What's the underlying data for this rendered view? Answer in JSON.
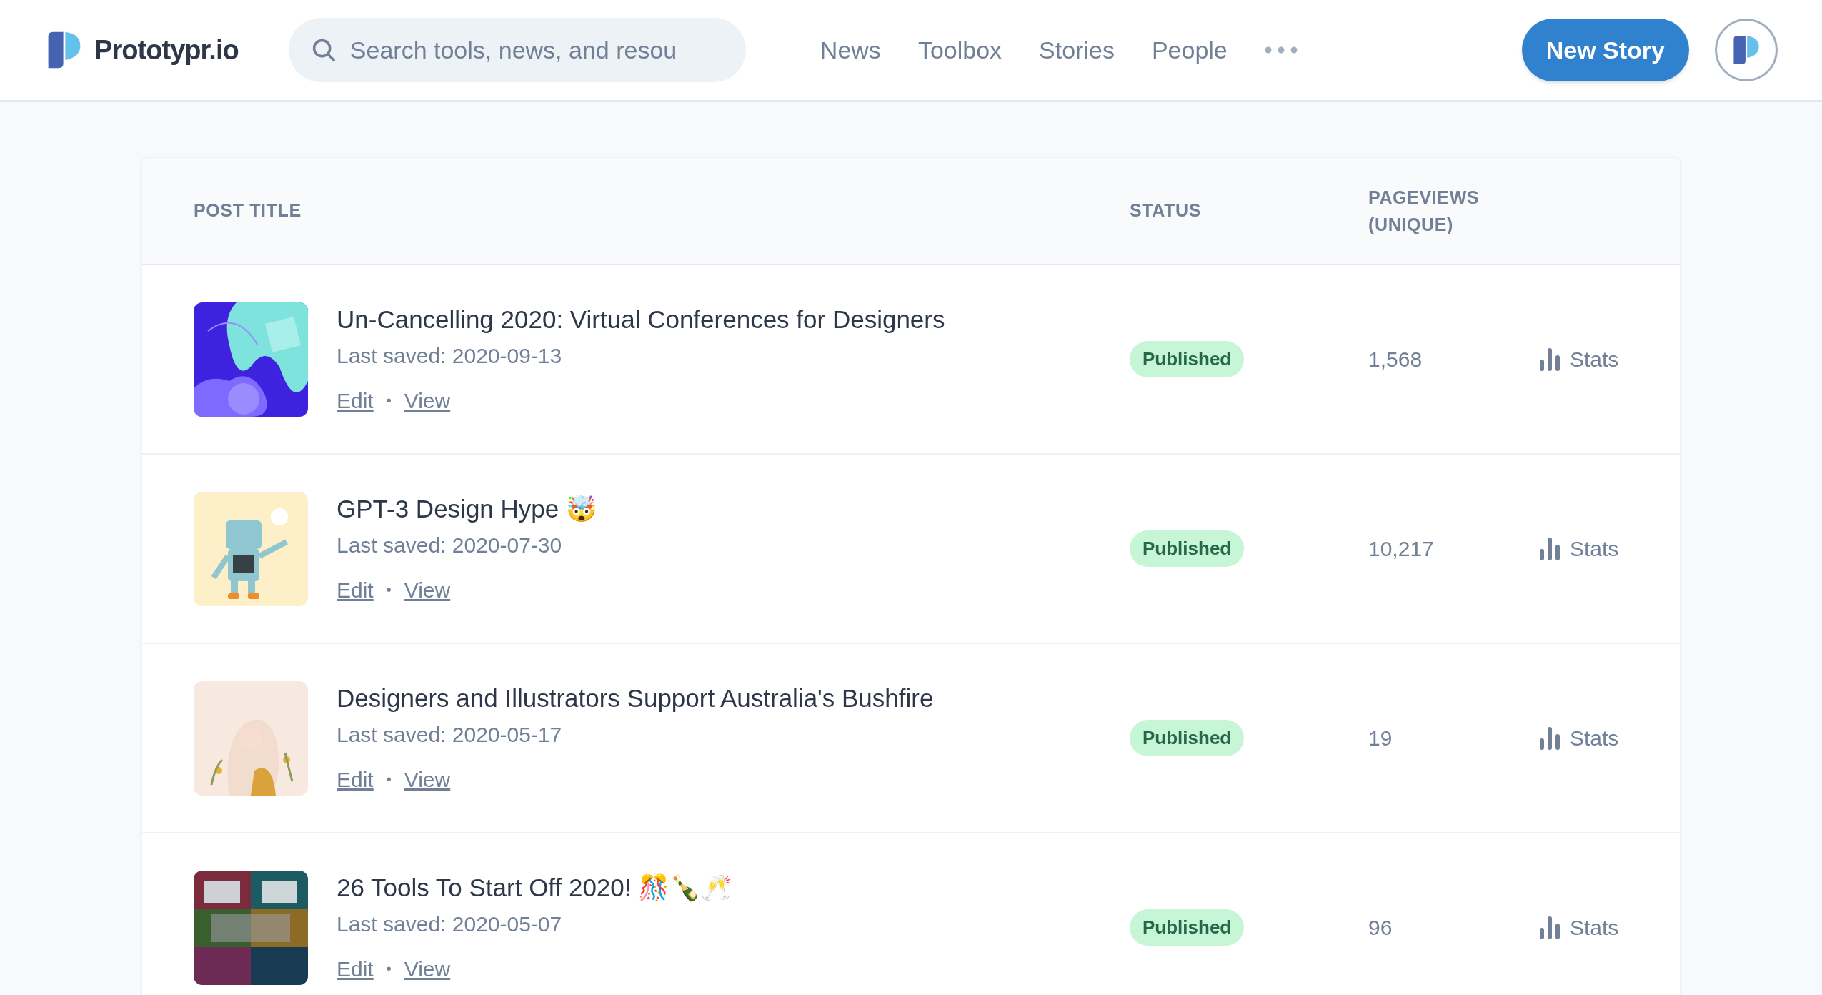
{
  "header": {
    "logo_text": "Prototypr.io",
    "search": {
      "placeholder": "Search tools, news, and resou"
    },
    "nav": [
      "News",
      "Toolbox",
      "Stories",
      "People"
    ],
    "new_story_button": "New Story"
  },
  "table": {
    "columns": [
      "POST TITLE",
      "STATUS",
      "PAGEVIEWS (UNIQUE)"
    ],
    "rows": [
      {
        "title": "Un-Cancelling 2020: Virtual Conferences for Designers",
        "last_saved": "Last saved: 2020-09-13",
        "edit": "Edit",
        "separator": "•",
        "view": "View",
        "status": "Published",
        "pageviews": "1,568",
        "stats": "Stats"
      },
      {
        "title": "GPT-3 Design Hype 🤯",
        "last_saved": "Last saved: 2020-07-30",
        "edit": "Edit",
        "separator": "•",
        "view": "View",
        "status": "Published",
        "pageviews": "10,217",
        "stats": "Stats"
      },
      {
        "title": "Designers and Illustrators Support Australia's Bushfire",
        "last_saved": "Last saved: 2020-05-17",
        "edit": "Edit",
        "separator": "•",
        "view": "View",
        "status": "Published",
        "pageviews": "19",
        "stats": "Stats"
      },
      {
        "title": "26 Tools To Start Off 2020! 🎊🍾🥂",
        "last_saved": "Last saved: 2020-05-07",
        "edit": "Edit",
        "separator": "•",
        "view": "View",
        "status": "Published",
        "pageviews": "96",
        "stats": "Stats"
      }
    ]
  }
}
